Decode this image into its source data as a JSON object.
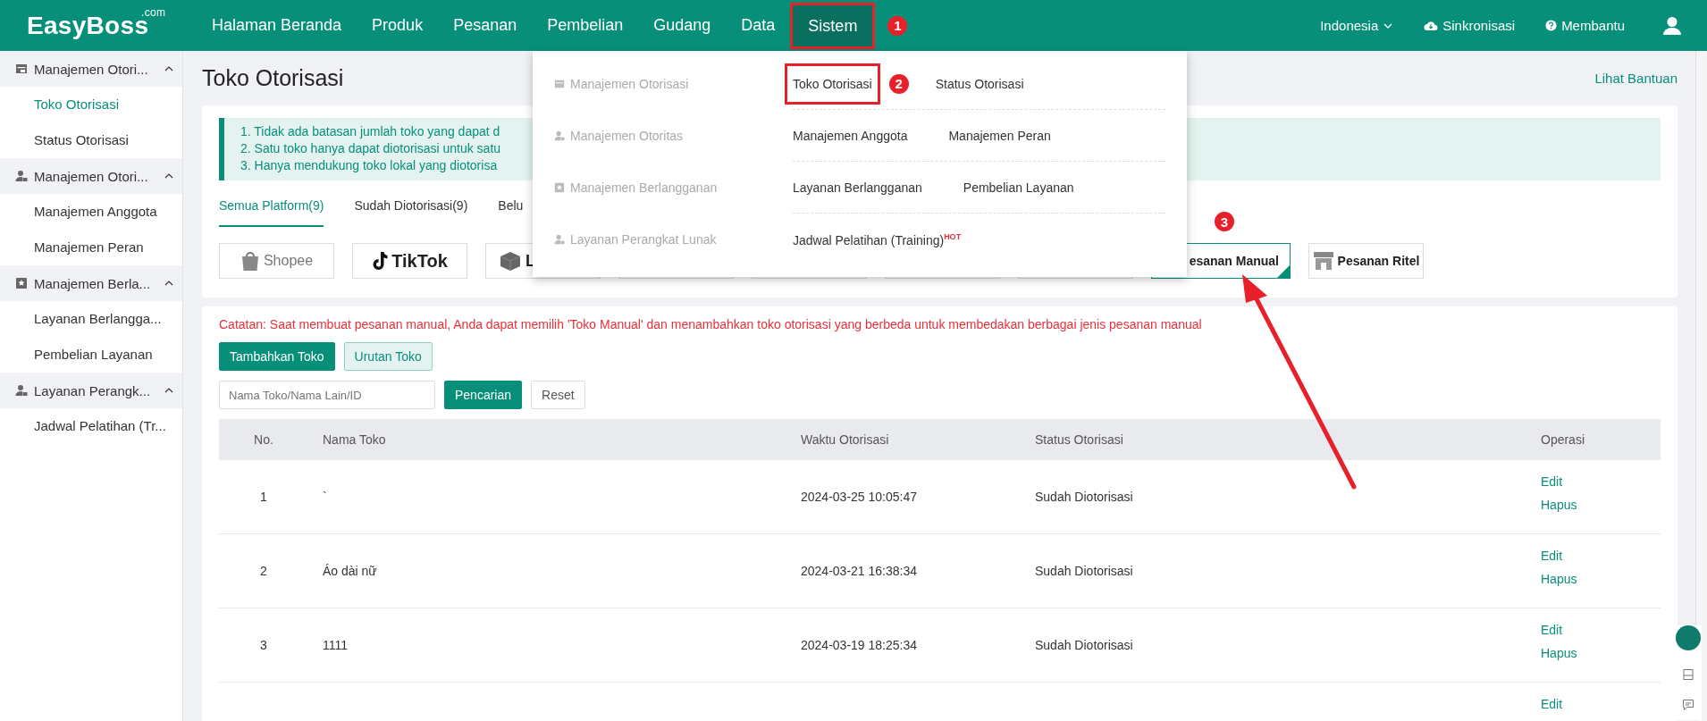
{
  "top_nav": {
    "logo": "EasyBoss",
    "logo_suffix": ".com",
    "items": [
      {
        "label": "Halaman Beranda",
        "selected": false,
        "highlighted": false
      },
      {
        "label": "Produk",
        "selected": false,
        "highlighted": false
      },
      {
        "label": "Pesanan",
        "selected": false,
        "highlighted": false
      },
      {
        "label": "Pembelian",
        "selected": false,
        "highlighted": false
      },
      {
        "label": "Gudang",
        "selected": false,
        "highlighted": false
      },
      {
        "label": "Data",
        "selected": false,
        "highlighted": false
      },
      {
        "label": "Sistem",
        "selected": true,
        "highlighted": true,
        "marker": "1"
      }
    ],
    "region": "Indonesia",
    "sync": "Sinkronisasi",
    "help": "Membantu"
  },
  "sidebar": {
    "groups": [
      {
        "label": "Manajemen Otori...",
        "expanded": true,
        "children": [
          {
            "label": "Toko Otorisasi",
            "selected": true
          },
          {
            "label": "Status Otorisasi",
            "selected": false
          }
        ]
      },
      {
        "label": "Manajemen Otori...",
        "expanded": true,
        "children": [
          {
            "label": "Manajemen Anggota",
            "selected": false
          },
          {
            "label": "Manajemen Peran",
            "selected": false
          }
        ]
      },
      {
        "label": "Manajemen Berla...",
        "expanded": true,
        "children": [
          {
            "label": "Layanan Berlangga...",
            "selected": false
          },
          {
            "label": "Pembelian Layanan",
            "selected": false
          }
        ]
      },
      {
        "label": "Layanan Perangk...",
        "expanded": true,
        "children": [
          {
            "label": "Jadwal Pelatihan (Tr...",
            "selected": false
          }
        ]
      }
    ]
  },
  "page": {
    "title": "Toko Otorisasi",
    "help_link": "Lihat Bantuan"
  },
  "notice": {
    "lines": [
      "1. Tidak ada batasan jumlah toko yang dapat d",
      "2. Satu toko hanya dapat diotorisasi untuk satu",
      "3. Hanya mendukung toko lokal yang diotorisa"
    ]
  },
  "platform_tabs": [
    {
      "label": "Semua Platform(9)",
      "selected": true
    },
    {
      "label": "Sudah Diotorisasi(9)",
      "selected": false
    },
    {
      "label": "Belu",
      "selected": false
    }
  ],
  "platform_tiles": [
    {
      "label": "Shopee",
      "selected": false
    },
    {
      "label": "TikTok",
      "selected": false
    },
    {
      "label": "L",
      "selected": false
    },
    {
      "selected": false
    },
    {
      "selected": false
    },
    {
      "selected": false
    },
    {
      "selected": false
    },
    {
      "label": "esanan Manual",
      "selected": true,
      "marker": "3"
    },
    {
      "label": "Pesanan Ritel",
      "selected": false
    }
  ],
  "note": "Catatan: Saat membuat pesanan manual, Anda dapat memilih 'Toko Manual' dan menambahkan toko otorisasi yang berbeda untuk membedakan berbagai jenis pesanan manual",
  "actions": {
    "add": "Tambahkan Toko",
    "order": "Urutan Toko"
  },
  "search": {
    "placeholder": "Nama Toko/Nama Lain/ID",
    "button": "Pencarian",
    "reset": "Reset"
  },
  "table": {
    "columns": [
      "No.",
      "Nama Toko",
      "Waktu Otorisasi",
      "Status Otorisasi",
      "Operasi"
    ],
    "rows": [
      {
        "no": "1",
        "name": "`",
        "time": "2024-03-25 10:05:47",
        "status": "Sudah Diotorisasi",
        "operations": [
          "Edit",
          "Hapus"
        ]
      },
      {
        "no": "2",
        "name": "Áo dài nữ",
        "time": "2024-03-21 16:38:34",
        "status": "Sudah Diotorisasi",
        "operations": [
          "Edit",
          "Hapus"
        ]
      },
      {
        "no": "3",
        "name": "1111",
        "time": "2024-03-19 18:25:34",
        "status": "Sudah Diotorisasi",
        "operations": [
          "Edit",
          "Hapus"
        ]
      },
      {
        "operations": [
          "Edit"
        ]
      }
    ]
  },
  "dropdown": {
    "groups": [
      {
        "label": "Manajemen Otorisasi",
        "items": [
          {
            "label": "Toko Otorisasi",
            "highlighted": true,
            "marker": "2"
          },
          {
            "label": "Status Otorisasi",
            "highlighted": false
          }
        ]
      },
      {
        "label": "Manajemen Otoritas",
        "items": [
          {
            "label": "Manajemen Anggota",
            "highlighted": false
          },
          {
            "label": "Manajemen Peran",
            "highlighted": false
          }
        ]
      },
      {
        "label": "Manajemen Berlangganan",
        "items": [
          {
            "label": "Layanan Berlangganan",
            "highlighted": false
          },
          {
            "label": "Pembelian Layanan",
            "highlighted": false
          }
        ]
      },
      {
        "label": "Layanan Perangkat Lunak",
        "items": [
          {
            "label": "Jadwal Pelatihan (Training)",
            "highlighted": false,
            "badge": "HOT"
          }
        ]
      }
    ]
  }
}
